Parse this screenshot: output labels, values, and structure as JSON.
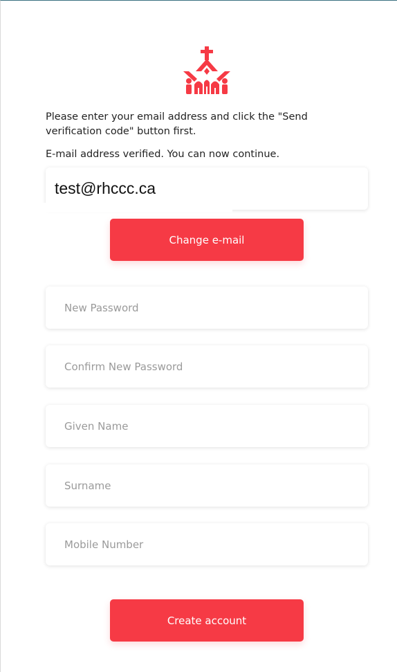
{
  "brand": {
    "logo_icon": "church-cross-logo-icon",
    "accent_color": "#f63a45"
  },
  "instructions": {
    "intro": "Please enter your email address and click the \"Send verification code\" button first.",
    "verified": "E-mail address verified. You can now continue."
  },
  "email": {
    "value": "test@rhccc.ca"
  },
  "buttons": {
    "change_email": "Change e-mail",
    "create_account": "Create account"
  },
  "fields": {
    "new_password": "New Password",
    "confirm_password": "Confirm New Password",
    "given_name": "Given Name",
    "surname": "Surname",
    "mobile": "Mobile Number"
  }
}
